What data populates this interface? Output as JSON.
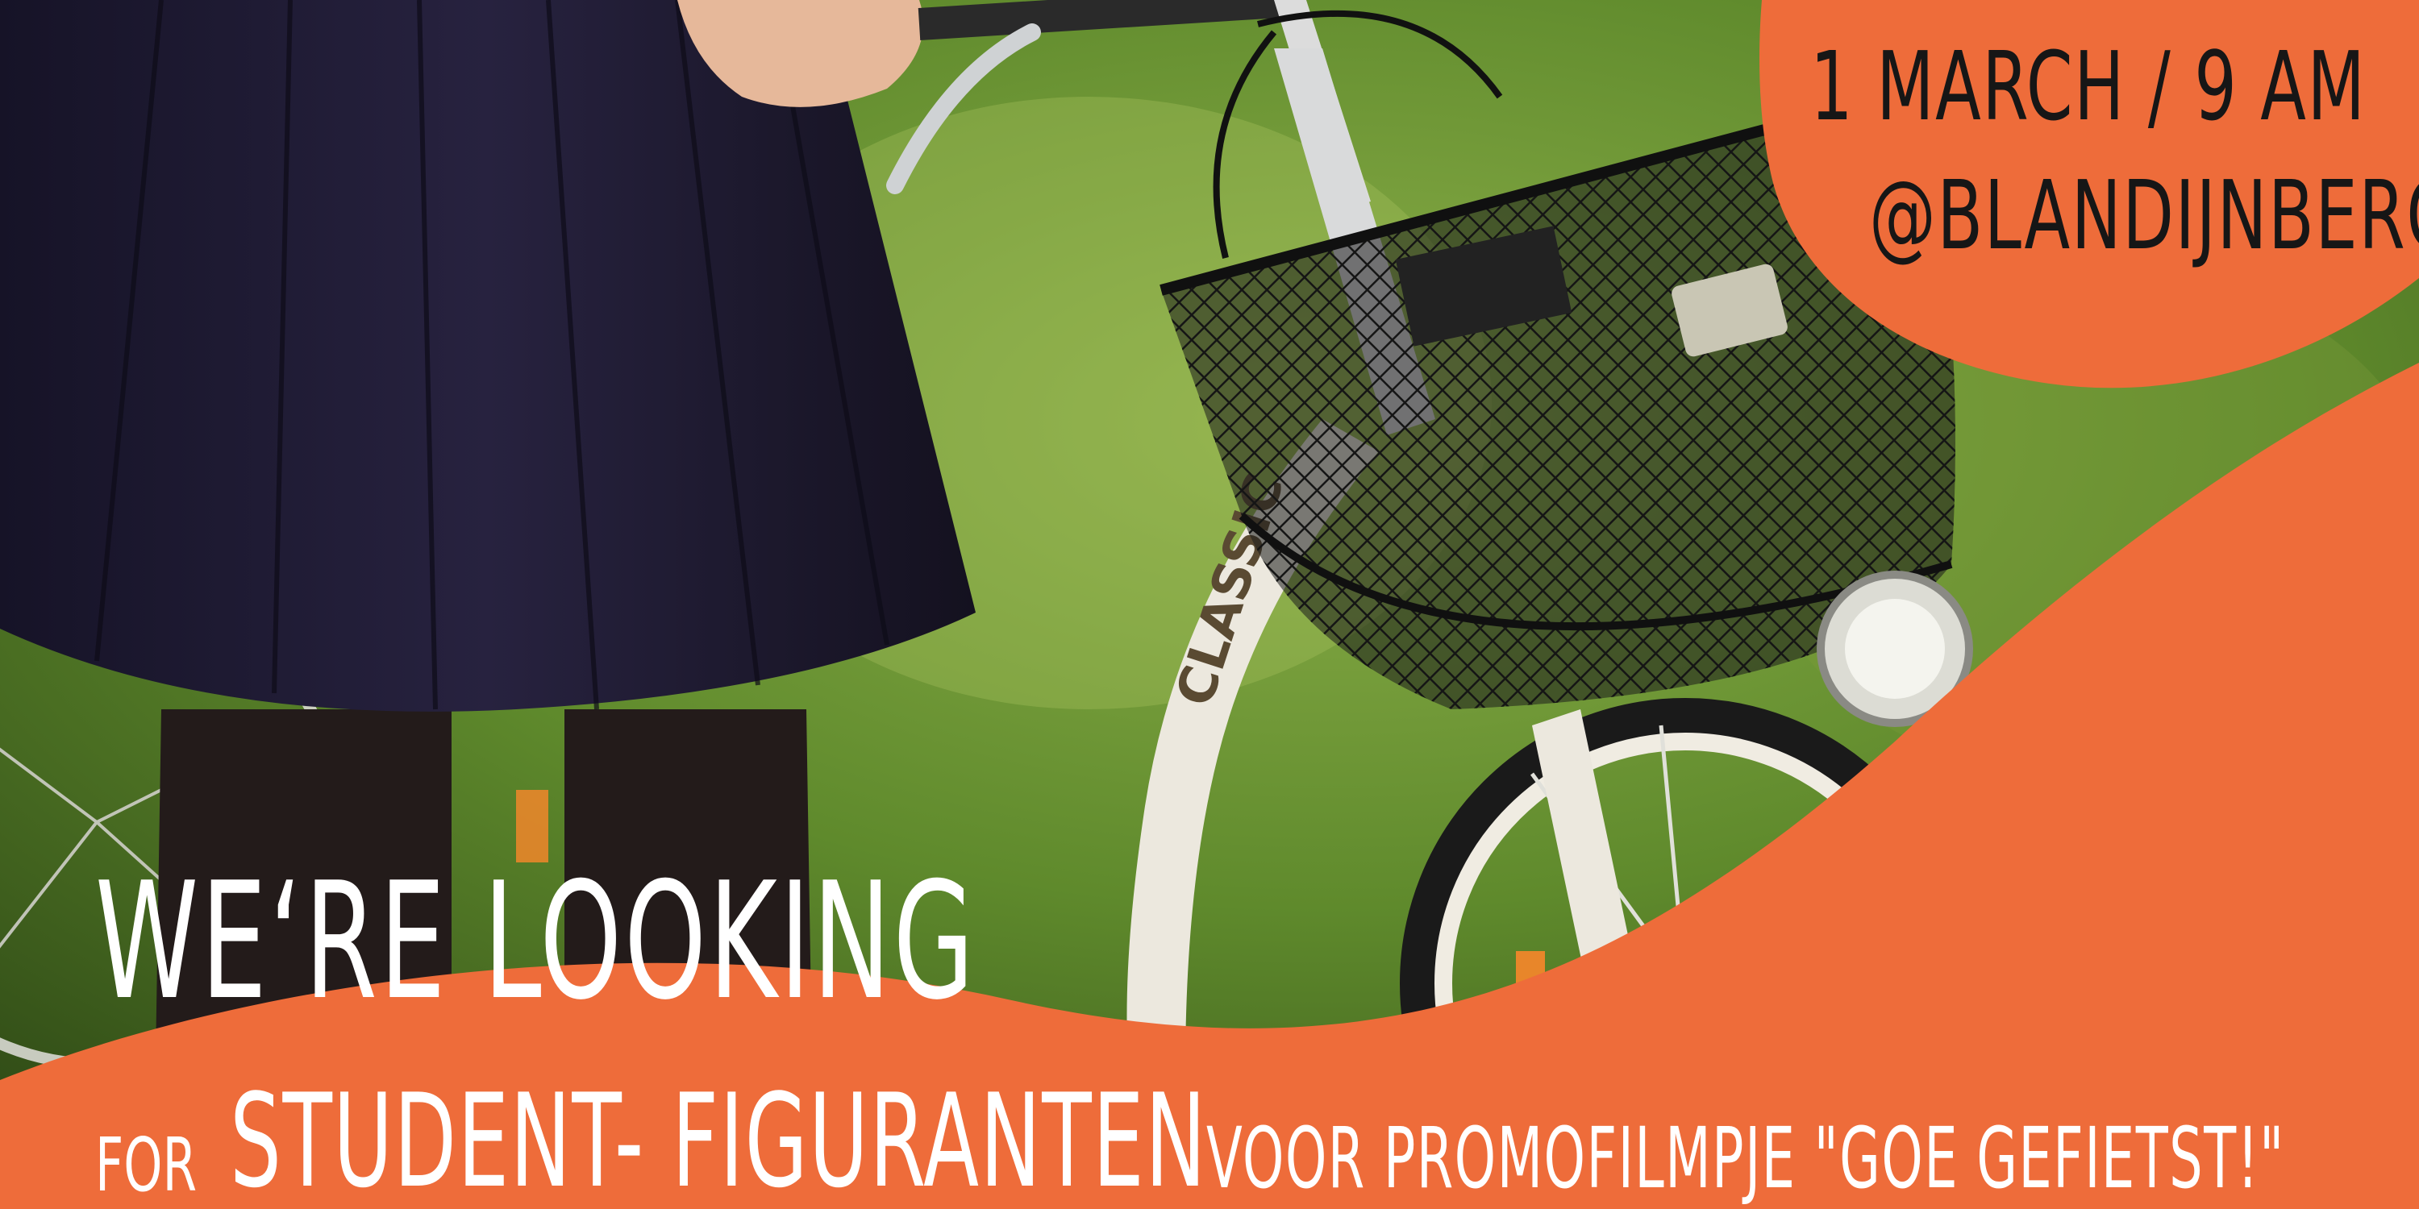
{
  "event": {
    "date_time": "1 MARCH  /  9 AM",
    "location": "@BLANDIJNBERG"
  },
  "headline": "WE‘RE LOOKING",
  "subline": {
    "for": "FOR",
    "role": "STUDENT- FIGURANTEN",
    "purpose": "VOOR PROMOFILMPJE \"GOE GEFIETST!\""
  },
  "photo": {
    "bike_brand": "CLASSIC"
  },
  "colors": {
    "accent_orange": "#ee6c3a",
    "grass": "#5f8a2c",
    "skirt": "#1e1a33",
    "text_dark": "#161616",
    "text_light": "#ffffff"
  }
}
